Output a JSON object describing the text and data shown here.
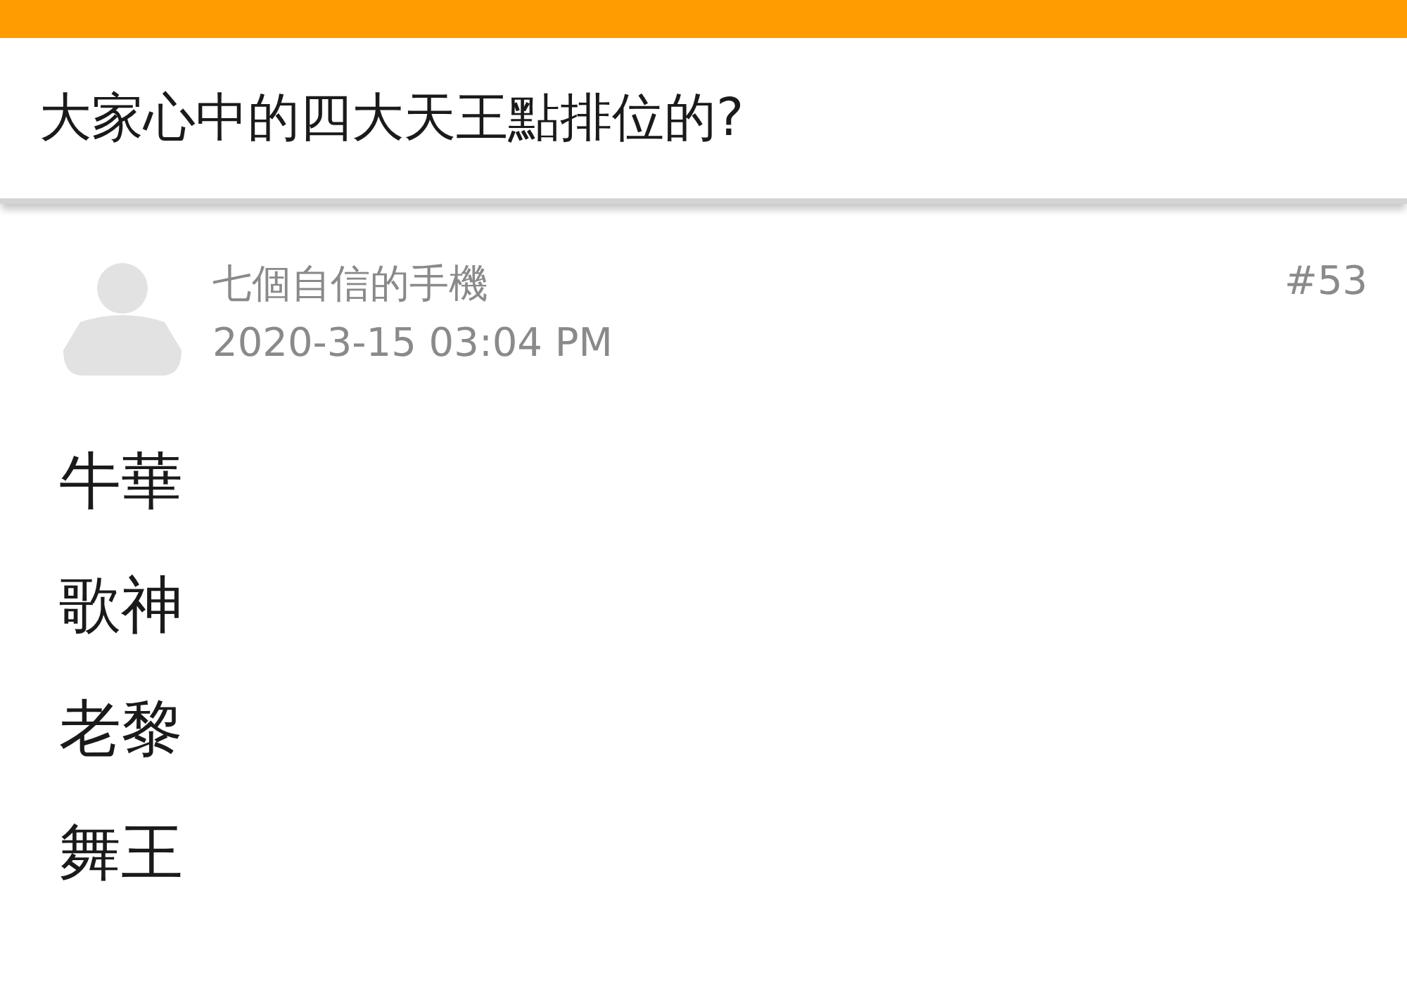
{
  "thread": {
    "title": "大家心中的四大天王點排位的?"
  },
  "post": {
    "author": "七個自信的手機",
    "time": "2020-3-15 03:04 PM",
    "number": "#53",
    "lines": [
      "牛華",
      "歌神",
      "老黎",
      "舞王"
    ]
  }
}
